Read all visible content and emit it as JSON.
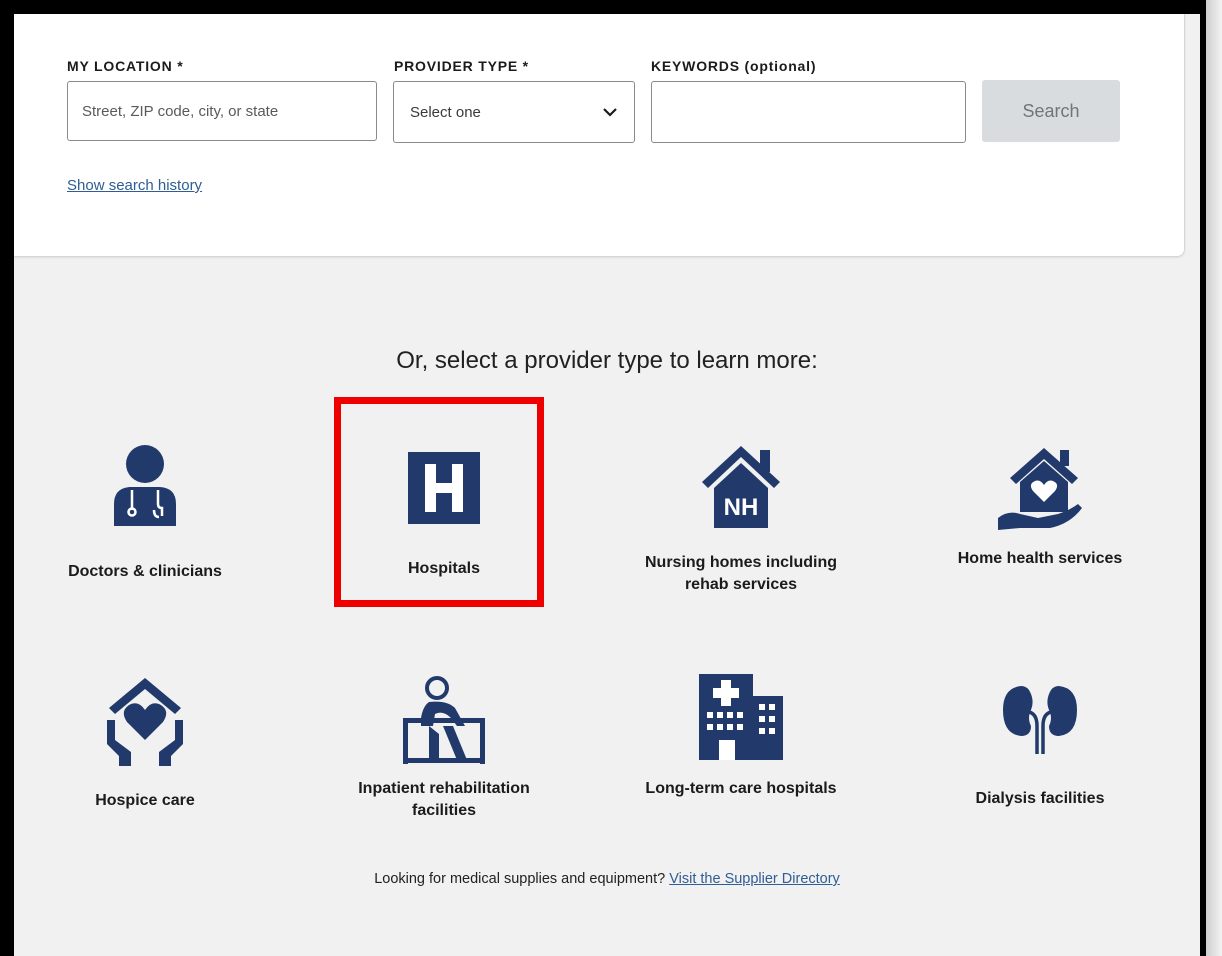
{
  "search": {
    "location_label": "MY LOCATION *",
    "location_placeholder": "Street, ZIP code, city, or state",
    "provider_label": "PROVIDER TYPE *",
    "provider_selected": "Select one",
    "keywords_label": "KEYWORDS (optional)",
    "keywords_value": "",
    "search_button": "Search",
    "history_link": "Show search history"
  },
  "heading": "Or, select a provider type to learn more:",
  "provider_types": [
    {
      "label": "Doctors & clinicians",
      "icon": "doctor-icon"
    },
    {
      "label": "Hospitals",
      "icon": "hospital-icon"
    },
    {
      "label": "Nursing homes including rehab services",
      "icon": "nursing-home-icon"
    },
    {
      "label": "Home health services",
      "icon": "home-health-icon"
    },
    {
      "label": "Hospice care",
      "icon": "hospice-icon"
    },
    {
      "label": "Inpatient rehabilitation facilities",
      "icon": "rehabilitation-icon"
    },
    {
      "label": "Long-term care hospitals",
      "icon": "long-term-care-icon"
    },
    {
      "label": "Dialysis facilities",
      "icon": "kidney-icon"
    }
  ],
  "footer": {
    "text": "Looking for medical supplies and equipment?",
    "link": "Visit the Supplier Directory"
  },
  "colors": {
    "icon_navy": "#213a6b",
    "link_blue": "#2f5d95",
    "highlight_red": "#ee0000"
  }
}
